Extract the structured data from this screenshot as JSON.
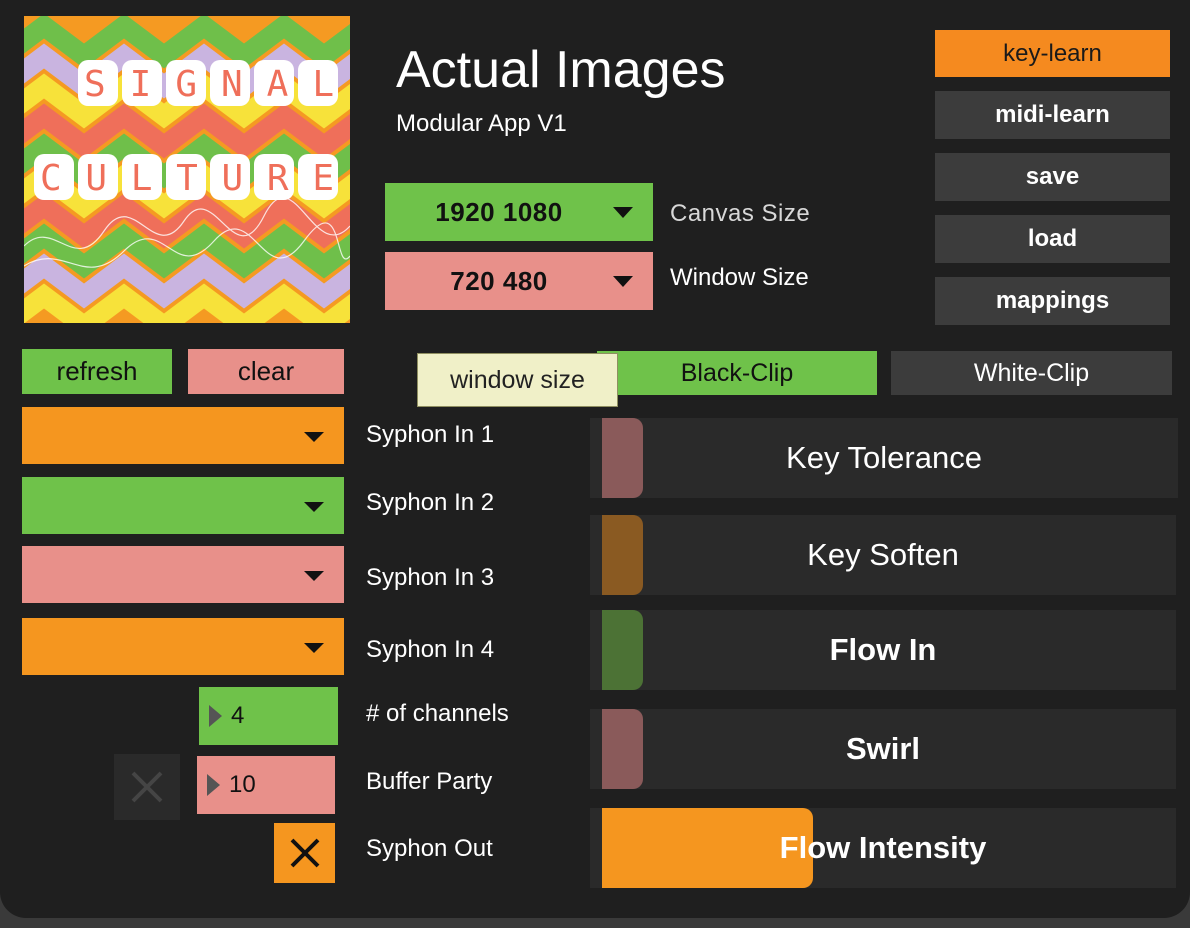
{
  "app": {
    "title": "Actual Images",
    "subtitle": "Modular App V1",
    "logo_line1": "SIGNAL",
    "logo_line2": "CULTURE"
  },
  "canvas_size": {
    "value": "1920 1080",
    "label": "Canvas Size",
    "color": "#6fc24a"
  },
  "window_size": {
    "value": "720 480",
    "label": "Window Size",
    "color": "#e8908a"
  },
  "side_buttons": [
    {
      "label": "key-learn",
      "active": true
    },
    {
      "label": "midi-learn"
    },
    {
      "label": "save"
    },
    {
      "label": "load"
    },
    {
      "label": "mappings"
    }
  ],
  "buttons": {
    "refresh": "refresh",
    "clear": "clear"
  },
  "tooltip": "window size",
  "clip_toggle": {
    "black": "Black-Clip",
    "white": "White-Clip",
    "selected": "Black-Clip"
  },
  "syphon_inputs": [
    {
      "label": "Syphon In 1",
      "color": "#f5961f"
    },
    {
      "label": "Syphon In 2",
      "color": "#6fc24a"
    },
    {
      "label": "Syphon In 3",
      "color": "#e8908a"
    },
    {
      "label": "Syphon In 4",
      "color": "#f5961f"
    }
  ],
  "channels": {
    "label": "# of channels",
    "value": "4"
  },
  "buffer_party": {
    "label": "Buffer Party",
    "value": "10",
    "checked": false
  },
  "syphon_out": {
    "label": "Syphon Out",
    "checked": true
  },
  "sliders": [
    {
      "label": "Key Tolerance",
      "fraction": 0.07,
      "color": "#8a5a5a",
      "bold": false
    },
    {
      "label": "Key Soften",
      "fraction": 0.07,
      "color": "#8a5a22",
      "bold": false
    },
    {
      "label": "Flow In",
      "fraction": 0.07,
      "color": "#4c7235",
      "bold": true
    },
    {
      "label": "Swirl",
      "fraction": 0.07,
      "color": "#8a5a5a",
      "bold": true
    },
    {
      "label": "Flow Intensity",
      "fraction": 0.36,
      "color": "#f5961f",
      "bold": true
    }
  ],
  "colors": {
    "background": "#1f1f1f",
    "orange": "#f5961f",
    "green": "#6fc24a",
    "pink": "#e8908a",
    "button_gray": "#3c3c3c"
  }
}
